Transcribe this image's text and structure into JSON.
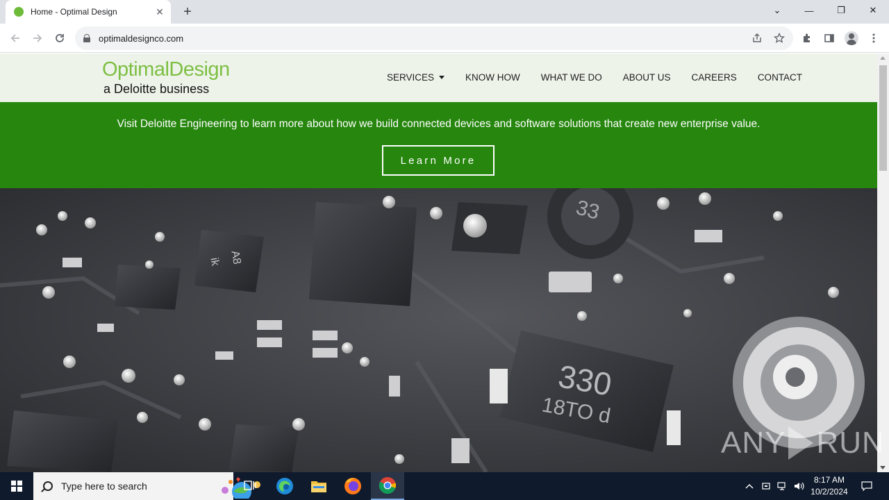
{
  "browser": {
    "tab_title": "Home - Optimal Design",
    "tab_close": "✕",
    "new_tab": "+",
    "url": "optimaldesignco.com",
    "window_controls": {
      "tabs_menu": "⌄",
      "minimize": "—",
      "restore": "❐",
      "close": "✕"
    }
  },
  "site": {
    "logo_name": "OptimalDesign",
    "logo_sub": "a Deloitte business",
    "nav": [
      {
        "label": "SERVICES",
        "has_dropdown": true
      },
      {
        "label": "KNOW HOW"
      },
      {
        "label": "WHAT WE DO"
      },
      {
        "label": "ABOUT US"
      },
      {
        "label": "CAREERS"
      },
      {
        "label": "CONTACT"
      }
    ],
    "banner_text": "Visit Deloitte Engineering to learn more about how we build connected devices and software solutions that create new enterprise value.",
    "banner_button": "Learn More",
    "hero_chip_labels": [
      "330",
      "18TO d",
      "33",
      "A8",
      "ik"
    ]
  },
  "watermark": {
    "left": "ANY",
    "right": "RUN"
  },
  "taskbar": {
    "search_placeholder": "Type here to search",
    "time": "8:17 AM",
    "date": "10/2/2024"
  },
  "colors": {
    "banner_green": "#26860e",
    "logo_green": "#7cbf42",
    "header_bg": "#eef3ea",
    "taskbar": "#0f1a2c"
  }
}
